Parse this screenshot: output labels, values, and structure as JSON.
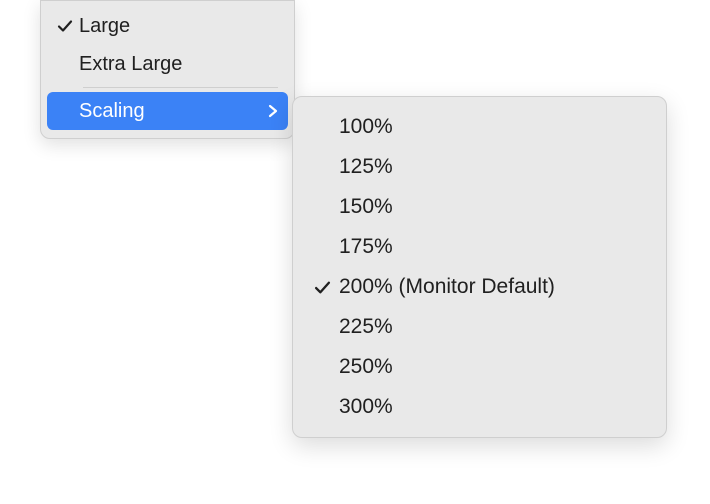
{
  "sizeMenu": {
    "items": [
      {
        "label": "Large",
        "checked": true
      },
      {
        "label": "Extra Large",
        "checked": false
      }
    ],
    "scalingLabel": "Scaling"
  },
  "scalingSubmenu": {
    "items": [
      {
        "label": "100%",
        "checked": false
      },
      {
        "label": "125%",
        "checked": false
      },
      {
        "label": "150%",
        "checked": false
      },
      {
        "label": "175%",
        "checked": false
      },
      {
        "label": "200% (Monitor Default)",
        "checked": true
      },
      {
        "label": "225%",
        "checked": false
      },
      {
        "label": "250%",
        "checked": false
      },
      {
        "label": "300%",
        "checked": false
      }
    ]
  }
}
